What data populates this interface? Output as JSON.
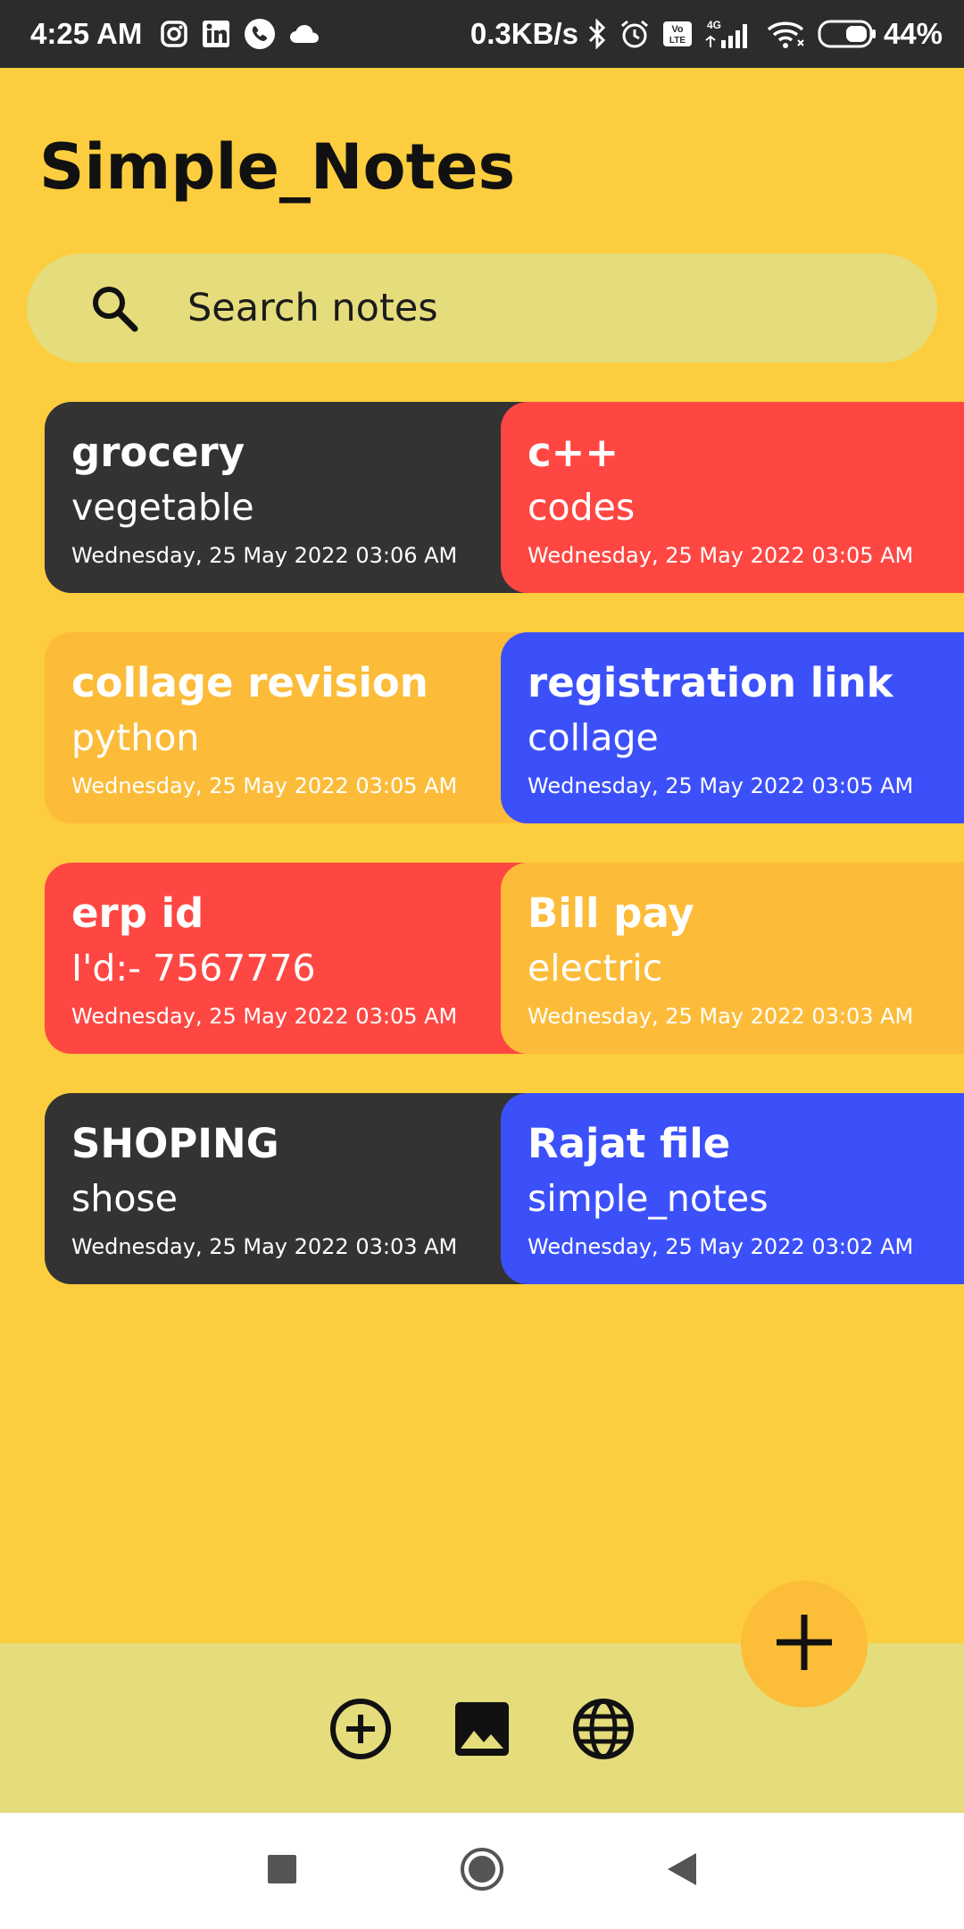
{
  "status_bar": {
    "time": "4:25 AM",
    "left_icons": [
      "instagram-icon",
      "linkedin-icon",
      "phone-icon",
      "cloud-icon"
    ],
    "net_speed": "0.3KB/s",
    "right_icons": [
      "bluetooth-icon",
      "alarm-icon",
      "volte-icon",
      "signal-icon",
      "wifi-icon",
      "battery-icon"
    ],
    "network_type": "4G",
    "volte_label": "Vo LTE",
    "battery": "44%"
  },
  "app": {
    "title": "Simple_Notes"
  },
  "search": {
    "placeholder": "Search notes"
  },
  "notes": [
    {
      "title": "grocery",
      "subtitle": "vegetable",
      "date": "Wednesday, 25 May 2022 03:06 AM",
      "color": "#333333"
    },
    {
      "title": "c++",
      "subtitle": "codes",
      "date": "Wednesday, 25 May 2022 03:05 AM",
      "color": "#fe4742"
    },
    {
      "title": "collage revision",
      "subtitle": "python",
      "date": "Wednesday, 25 May 2022 03:05 AM",
      "color": "#fcbc39"
    },
    {
      "title": "registration link",
      "subtitle": "collage",
      "date": "Wednesday, 25 May 2022 03:05 AM",
      "color": "#3c50fa"
    },
    {
      "title": "erp id",
      "subtitle": "I'd:- 7567776",
      "date": "Wednesday, 25 May 2022 03:05 AM",
      "color": "#fe4742"
    },
    {
      "title": "Bill pay",
      "subtitle": "electric",
      "date": "Wednesday, 25 May 2022 03:03 AM",
      "color": "#fcbc39"
    },
    {
      "title": "SHOPING",
      "subtitle": "shose",
      "date": "Wednesday, 25 May 2022 03:03 AM",
      "color": "#333333"
    },
    {
      "title": "Rajat file",
      "subtitle": "simple_notes",
      "date": "Wednesday, 25 May 2022 03:02 AM",
      "color": "#3c50fa"
    }
  ],
  "fab": {
    "icon": "plus-icon",
    "color": "#fcbd39"
  },
  "bottom_bar": {
    "items": [
      "add-circle-icon",
      "image-icon",
      "globe-icon"
    ]
  },
  "nav_bar": {
    "items": [
      "recents-square-icon",
      "home-circle-icon",
      "back-triangle-icon"
    ]
  },
  "colors": {
    "background": "#fccd3e",
    "search_bg": "#e5dc7c",
    "status_bar": "#2c2c2c"
  }
}
